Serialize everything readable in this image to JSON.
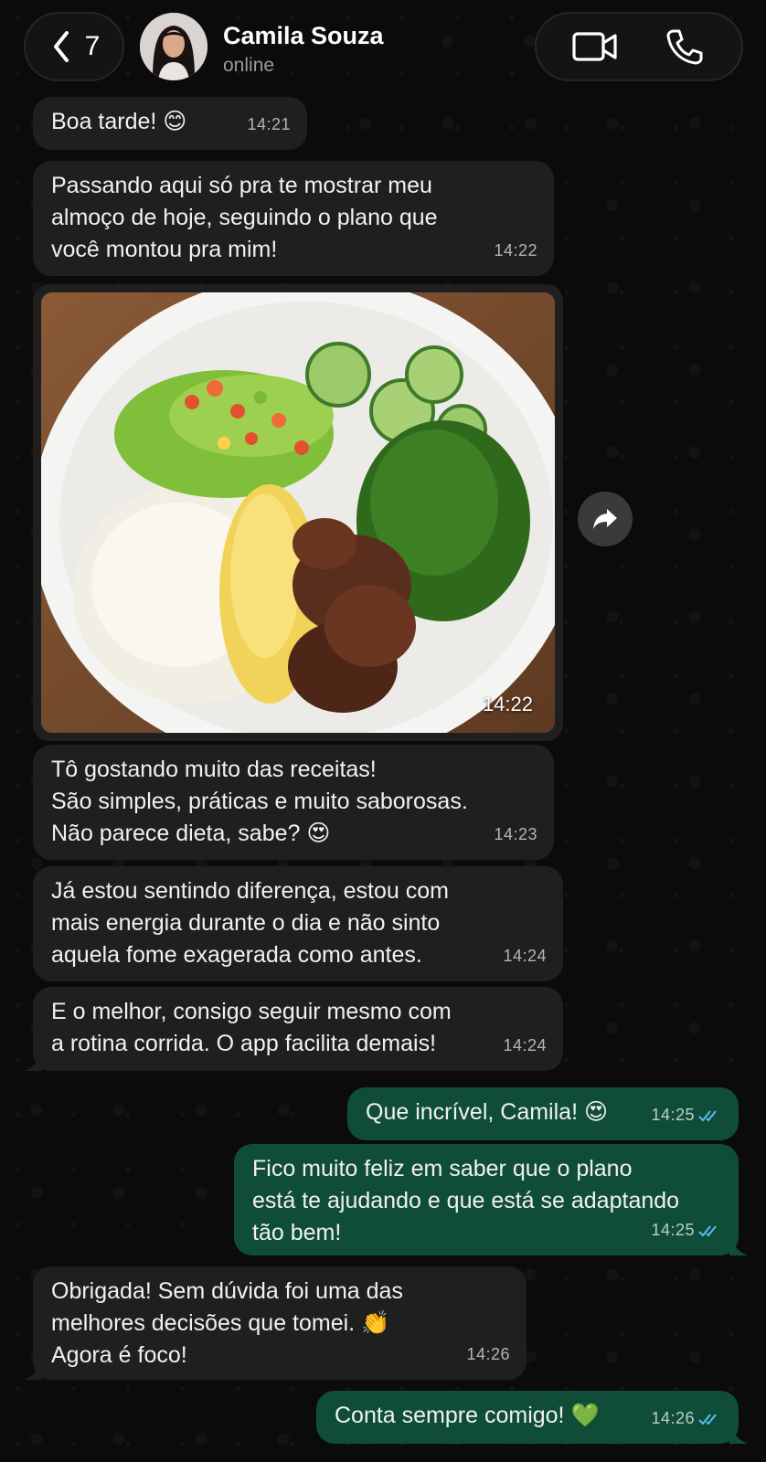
{
  "header": {
    "back_count": "7",
    "contact_name": "Camila Souza",
    "contact_status": "online"
  },
  "messages": [
    {
      "direction": "incoming",
      "lines": [
        "Boa tarde! 😊"
      ],
      "time": "14:21"
    },
    {
      "direction": "incoming",
      "lines": [
        "Passando aqui só pra te mostrar meu",
        "almoço de hoje, seguindo o plano que",
        "você montou pra mim!"
      ],
      "time": "14:22"
    },
    {
      "direction": "incoming",
      "type": "image",
      "time": "14:22"
    },
    {
      "direction": "incoming",
      "lines": [
        "Tô gostando muito das receitas!",
        "São simples, práticas e muito saborosas.",
        "Não parece dieta, sabe? 😍"
      ],
      "time": "14:23"
    },
    {
      "direction": "incoming",
      "lines": [
        "Já estou sentindo diferença, estou com",
        "mais energia durante o dia e não sinto",
        "aquela fome exagerada como antes."
      ],
      "time": "14:24"
    },
    {
      "direction": "incoming",
      "lines": [
        "E o melhor, consigo seguir mesmo com",
        "a rotina corrida. O app facilita demais!"
      ],
      "time": "14:24"
    },
    {
      "direction": "outgoing",
      "lines": [
        "Que incrível, Camila! 😍"
      ],
      "time": "14:25"
    },
    {
      "direction": "outgoing",
      "lines": [
        "Fico muito feliz em saber que o plano",
        "está te ajudando e que está se adaptando",
        "tão bem!"
      ],
      "time": "14:25"
    },
    {
      "direction": "incoming",
      "lines": [
        "Obrigada! Sem dúvida foi uma das",
        "melhores decisões que tomei. 👏",
        "Agora é foco!"
      ],
      "time": "14:26"
    },
    {
      "direction": "outgoing",
      "lines": [
        "Conta sempre comigo! 💚"
      ],
      "time": "14:26"
    }
  ],
  "icons": {
    "back": "chevron-left-icon",
    "video": "video-camera-icon",
    "phone": "phone-icon",
    "forward": "forward-arrow-icon",
    "read_receipt": "double-check-icon"
  },
  "colors": {
    "background": "#0b0b0b",
    "incoming_bubble": "#1f1f1f",
    "outgoing_bubble": "#0f4d39",
    "read_tick": "#53bdeb"
  }
}
